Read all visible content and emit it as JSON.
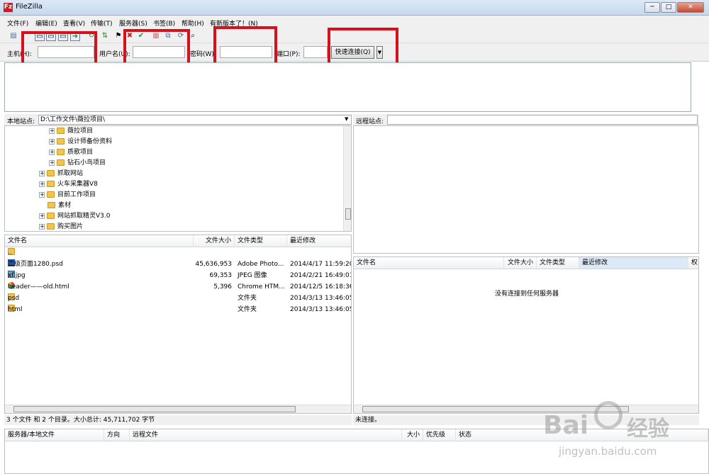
{
  "window": {
    "title": "FileZilla",
    "app_icon": "Fz"
  },
  "menu": [
    "文件(F)",
    "编辑(E)",
    "查看(V)",
    "传输(T)",
    "服务器(S)",
    "书签(B)",
    "帮助(H)",
    "有新版本了！(N)"
  ],
  "quickconnect": {
    "host_label": "主机(H):",
    "user_label": "用户名(U):",
    "pass_label": "密码(W):",
    "port_label": "端口(P):",
    "host_value": "",
    "user_value": "",
    "pass_value": "",
    "port_value": "",
    "button_label": "快速连接(Q)",
    "dropdown_glyph": "▼"
  },
  "local": {
    "site_label": "本地站点:",
    "path": "D:\\工作文件\\薇拉项目\\",
    "tree": [
      "薇拉项目",
      "设计师备份资料",
      "质歌项目",
      "钻石小鸟项目",
      "抓取网站",
      "火车采集器V8",
      "目前工作项目",
      "素材",
      "网站抓取精灵V3.0",
      "购买图片"
    ],
    "columns": [
      "文件名",
      "文件大小",
      "文件类型",
      "最近修改"
    ],
    "files": [
      {
        "name": "..",
        "size": "",
        "type": "",
        "date": "",
        "icon": "folder"
      },
      {
        "name": "二级页面1280.psd",
        "size": "45,636,953",
        "type": "Adobe Photo...",
        "date": "2014/4/17 11:59:20",
        "icon": "psd-file-icon"
      },
      {
        "name": "xf.jpg",
        "size": "69,353",
        "type": "JPEG 图像",
        "date": "2014/2/21 16:49:01",
        "icon": "image-file-icon"
      },
      {
        "name": "header——old.html",
        "size": "5,396",
        "type": "Chrome HTM...",
        "date": "2014/12/5 16:18:36",
        "icon": "chrome-file-icon"
      },
      {
        "name": "psd",
        "size": "",
        "type": "文件夹",
        "date": "2014/3/13 13:46:05",
        "icon": "folder"
      },
      {
        "name": "html",
        "size": "",
        "type": "文件夹",
        "date": "2014/3/13 13:46:05",
        "icon": "folder"
      }
    ],
    "status": "3 个文件 和 2 个目录。大小总计: 45,711,702 字节"
  },
  "remote": {
    "site_label": "远程站点:",
    "path": "",
    "columns": [
      "文件名",
      "文件大小",
      "文件类型",
      "最近修改",
      "权"
    ],
    "empty_message": "没有连接到任何服务器",
    "status": "未连接。"
  },
  "queue": {
    "columns": [
      "服务器/本地文件",
      "方向",
      "远程文件",
      "大小",
      "优先级",
      "状态"
    ]
  },
  "watermark": {
    "brand": "Bai",
    "brand2": "经验",
    "url": "jingyan.baidu.com"
  },
  "colors": {
    "annotation_red": "#d8101c",
    "folder_yellow": "#f1c452",
    "selection_blue": "#cce8ff"
  }
}
